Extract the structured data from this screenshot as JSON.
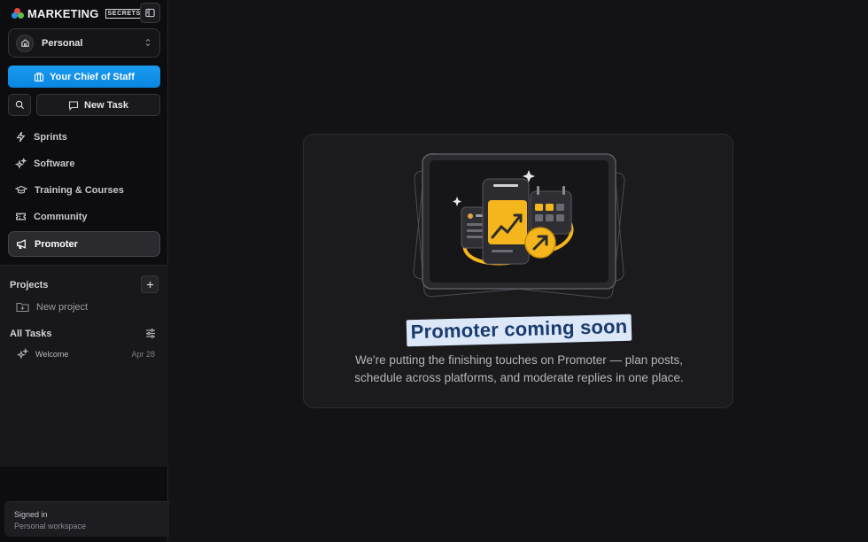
{
  "brand": {
    "name": "MARKETING",
    "tag": "SECRETS"
  },
  "workspace": {
    "label": "Personal"
  },
  "chief_button": {
    "label": "Your Chief of Staff"
  },
  "new_task": {
    "label": "New Task"
  },
  "nav": [
    {
      "label": "Sprints",
      "icon": "lightning-icon"
    },
    {
      "label": "Software",
      "icon": "sparkles-icon"
    },
    {
      "label": "Training & Courses",
      "icon": "graduation-cap-icon"
    },
    {
      "label": "Community",
      "icon": "ticket-icon"
    },
    {
      "label": "Promoter",
      "icon": "megaphone-icon",
      "active": true
    }
  ],
  "projects": {
    "heading": "Projects",
    "new_label": "New project"
  },
  "tasks": {
    "heading": "All Tasks",
    "items": [
      {
        "name": "Welcome",
        "date": "Apr 28"
      }
    ]
  },
  "user": {
    "status": "Signed in",
    "workspace": "Personal workspace"
  },
  "main": {
    "title": "Promoter coming soon",
    "description": "We're putting the finishing touches on Promoter — plan posts, schedule across platforms, and moderate replies in one place."
  },
  "colors": {
    "accent": "#0a86e0",
    "highlight": "#dce8f8",
    "title_text": "#1b3b6e",
    "illustration_gold": "#f5b51c"
  }
}
